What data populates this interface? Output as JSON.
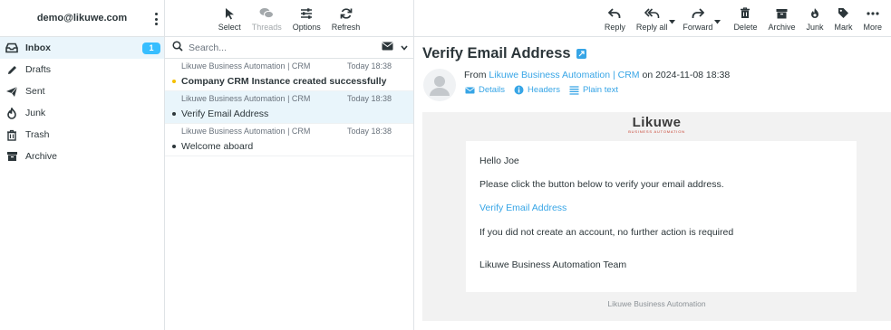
{
  "account": {
    "name": "demo@likuwe.com",
    "menu_icon": "kebab-icon"
  },
  "folders": [
    {
      "label": "Inbox",
      "icon": "inbox-icon",
      "count": "1",
      "selected": true
    },
    {
      "label": "Drafts",
      "icon": "pencil-icon"
    },
    {
      "label": "Sent",
      "icon": "paper-plane-icon"
    },
    {
      "label": "Junk",
      "icon": "fire-icon"
    },
    {
      "label": "Trash",
      "icon": "trash-icon"
    },
    {
      "label": "Archive",
      "icon": "archive-icon"
    }
  ],
  "list_toolbar": {
    "select": "Select",
    "threads": "Threads",
    "options": "Options",
    "refresh": "Refresh"
  },
  "search": {
    "placeholder": "Search..."
  },
  "messages": [
    {
      "from": "Likuwe Business Automation | CRM",
      "date": "Today 18:38",
      "subject": "Company CRM Instance created successfully",
      "unread": true
    },
    {
      "from": "Likuwe Business Automation | CRM",
      "date": "Today 18:38",
      "subject": "Verify Email Address",
      "selected": true
    },
    {
      "from": "Likuwe Business Automation | CRM",
      "date": "Today 18:38",
      "subject": "Welcome aboard"
    }
  ],
  "mail_toolbar": {
    "reply": "Reply",
    "reply_all": "Reply all",
    "forward": "Forward",
    "delete": "Delete",
    "archive": "Archive",
    "junk": "Junk",
    "mark": "Mark",
    "more": "More"
  },
  "mail": {
    "subject": "Verify Email Address",
    "from_prefix": "From",
    "from_name": "Likuwe Business Automation | CRM",
    "on_text": "on 2024-11-08 18:38",
    "links": {
      "details": "Details",
      "headers": "Headers",
      "plain_text": "Plain text"
    },
    "logo_text": "Likuwe",
    "logo_subtext": "BUSINESS AUTOMATION",
    "body": {
      "greeting": "Hello Joe",
      "instruction": "Please click the button below to verify your email address.",
      "button_link": "Verify Email Address",
      "note": "If you did not create an account, no further action is required",
      "signature": "Likuwe Business Automation Team"
    },
    "footer": "Likuwe Business Automation"
  },
  "colors": {
    "accent": "#37a5e6",
    "badge": "#37beff",
    "selected_bg": "#e9f5fb",
    "unread_dot": "#f5c000"
  }
}
